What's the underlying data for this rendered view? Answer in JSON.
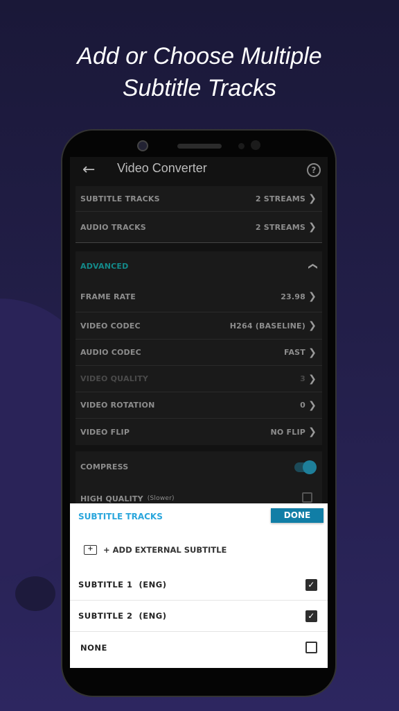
{
  "headline": {
    "line1": "Add or Choose Multiple",
    "line2": "Subtitle Tracks"
  },
  "header": {
    "back_icon": "arrow-left-icon",
    "title": "Video Converter",
    "help_icon": "question-circle-icon"
  },
  "rows": [
    {
      "label": "SUBTITLE TRACKS",
      "value": "2 STREAMS"
    },
    {
      "label": "AUDIO TRACKS",
      "value": "2 STREAMS"
    }
  ],
  "advanced": {
    "label": "ADVANCED",
    "accent": "#138a8a",
    "rows": [
      {
        "label": "FRAME RATE",
        "value": "23.98"
      },
      {
        "label": "VIDEO CODEC",
        "value": "H264 (BASELINE)"
      },
      {
        "label": "AUDIO CODEC",
        "value": "FAST"
      },
      {
        "label": "VIDEO QUALITY",
        "value": "3",
        "disabled": true
      },
      {
        "label": "VIDEO ROTATION",
        "value": "0"
      },
      {
        "label": "VIDEO FLIP",
        "value": "NO FLIP"
      }
    ]
  },
  "compress": {
    "label": "COMPRESS",
    "on": true
  },
  "high_quality": {
    "label": "HIGH QUALITY",
    "note": "(Slower)",
    "checked": false
  },
  "sheet": {
    "title": "SUBTITLE TRACKS",
    "done": "DONE",
    "add": "+ ADD EXTERNAL SUBTITLE",
    "title_color": "#2aa6dc",
    "button_color": "#117ea6",
    "options": [
      {
        "label": "SUBTITLE 1  (ENG)",
        "checked": true
      },
      {
        "label": "SUBTITLE 2  (ENG)",
        "checked": true
      },
      {
        "label": "NONE",
        "checked": false
      }
    ]
  }
}
